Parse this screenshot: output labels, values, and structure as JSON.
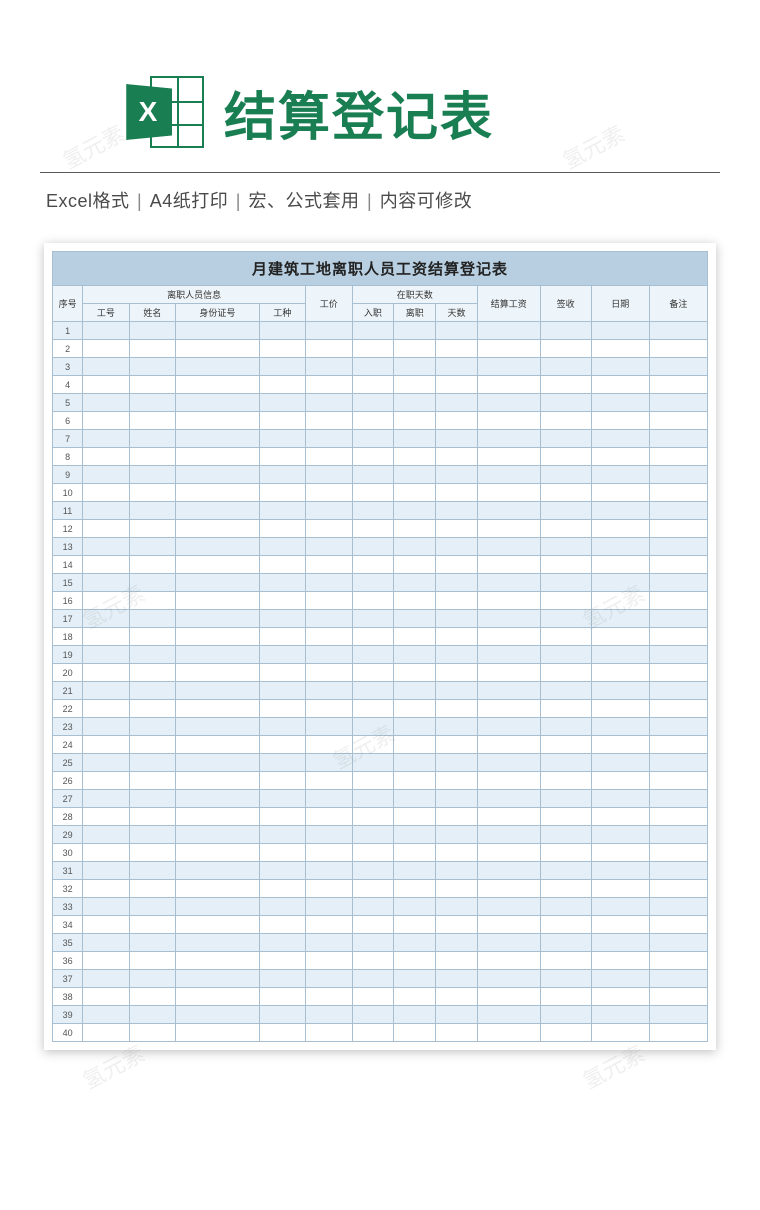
{
  "header": {
    "icon_letter": "X",
    "title": "结算登记表"
  },
  "meta": {
    "item1": "Excel格式",
    "item2": "A4纸打印",
    "item3": "宏、公式套用",
    "item4": "内容可修改",
    "separator": "|"
  },
  "sheet": {
    "title": "月建筑工地离职人员工资结算登记表",
    "headers": {
      "seq": "序号",
      "group_info": "离职人员信息",
      "group_days": "在职天数",
      "emp_no": "工号",
      "name": "姓名",
      "id_no": "身份证号",
      "job_type": "工种",
      "rate": "工价",
      "start": "入职",
      "end": "离职",
      "days": "天数",
      "settle": "结算工资",
      "sign": "签收",
      "date": "日期",
      "remark": "备注"
    },
    "row_count": 40
  },
  "watermark_text": "氢元素"
}
